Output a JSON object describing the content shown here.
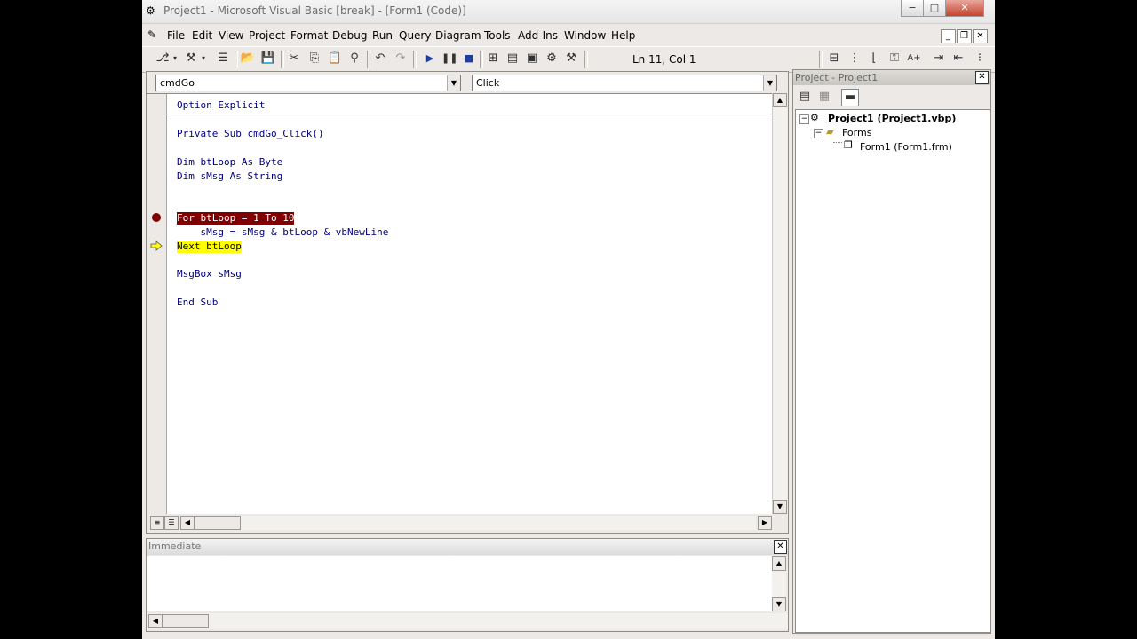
{
  "window": {
    "title": "Project1 - Microsoft Visual Basic [break] - [Form1 (Code)]",
    "min_label": "−",
    "max_label": "□",
    "close_label": "✕"
  },
  "menu": {
    "items": [
      "File",
      "Edit",
      "View",
      "Project",
      "Format",
      "Debug",
      "Run",
      "Query",
      "Diagram",
      "Tools",
      "Add-Ins",
      "Window",
      "Help"
    ],
    "mdi_min": "_",
    "mdi_restore": "❐",
    "mdi_close": "✕"
  },
  "toolbar": {
    "position": "Ln 11, Col 1"
  },
  "code": {
    "object_combo": "cmdGo",
    "proc_combo": "Click",
    "lines": [
      "Option Explicit",
      "Private Sub cmdGo_Click()",
      "Dim btLoop As Byte",
      "Dim sMsg As String",
      "For btLoop = 1 To 10",
      "    sMsg = sMsg & btLoop & vbNewLine",
      "Next btLoop",
      "MsgBox sMsg",
      "End Sub"
    ]
  },
  "immediate": {
    "title": "Immediate"
  },
  "project": {
    "title": "Project - Project1",
    "tree": {
      "root": "Project1 (Project1.vbp)",
      "folder": "Forms",
      "item": "Form1 (Form1.frm)"
    }
  },
  "colors": {
    "breakpoint": "#800000",
    "current_line": "#ffff00",
    "code_text": "#000080"
  }
}
